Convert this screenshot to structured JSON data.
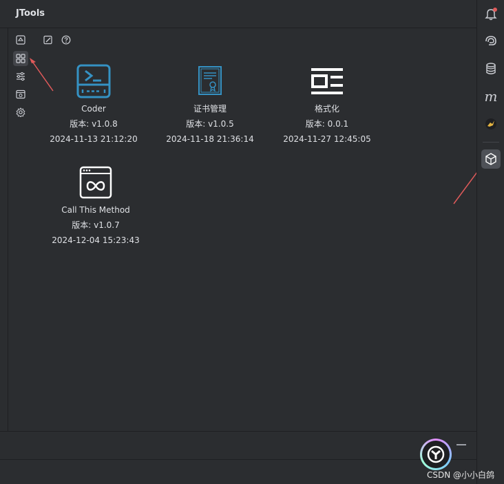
{
  "window": {
    "title": "JTools"
  },
  "left_toolbar": {
    "items": [
      {
        "name": "recycle-icon"
      },
      {
        "name": "grid-icon",
        "active": true
      },
      {
        "name": "sliders-icon"
      },
      {
        "name": "browser-icon"
      },
      {
        "name": "gear-icon"
      }
    ]
  },
  "content_toolbar": {
    "items": [
      {
        "name": "edit-icon"
      },
      {
        "name": "help-icon"
      }
    ]
  },
  "plugins": [
    {
      "icon": "terminal-icon",
      "name": "Coder",
      "version": "版本: v1.0.8",
      "date": "2024-11-13 21:12:20",
      "color": "#3592c4"
    },
    {
      "icon": "certificate-icon",
      "name": "证书管理",
      "version": "版本: v1.0.5",
      "date": "2024-11-18 21:36:14",
      "color": "#3592c4"
    },
    {
      "icon": "format-icon",
      "name": "格式化",
      "version": "版本: 0.0.1",
      "date": "2024-11-27 12:45:05",
      "color": "#ffffff"
    },
    {
      "icon": "method-icon",
      "name": "Call This Method",
      "version": "版本: v1.0.7",
      "date": "2024-12-04 15:23:43",
      "color": "#ffffff"
    }
  ],
  "right_stripe": {
    "items": [
      {
        "name": "notifications-icon",
        "badge": true
      },
      {
        "name": "ai-assistant-icon"
      },
      {
        "name": "database-icon"
      },
      {
        "name": "maven-icon",
        "label": "m"
      },
      {
        "name": "mybatis-bird-icon"
      },
      {
        "name": "jtools-cube-icon",
        "active": true
      }
    ]
  },
  "watermark": "CSDN @小小白鸽",
  "accent_color": "#e05a5a"
}
